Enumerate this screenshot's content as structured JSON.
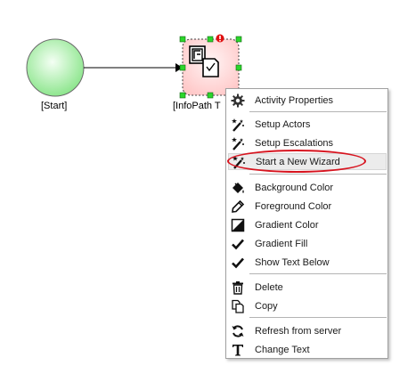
{
  "workflow": {
    "start_label": "[Start]",
    "infopath_label": "[InfoPath T",
    "colors": {
      "start_fill": "#8ee68e",
      "task_fill": "#ffd6d6",
      "handle": "#2bd62b",
      "warning": "#e01010"
    }
  },
  "context_menu": {
    "items": [
      {
        "label": "Activity Properties",
        "icon": "gear-icon"
      },
      {
        "label": "Setup Actors",
        "icon": "wand-icon"
      },
      {
        "label": "Setup Escalations",
        "icon": "wand-icon"
      },
      {
        "label": "Start a New Wizard",
        "icon": "wand-icon"
      },
      {
        "label": "Background Color",
        "icon": "paint-bucket-icon"
      },
      {
        "label": "Foreground Color",
        "icon": "pencil-icon"
      },
      {
        "label": "Gradient Color",
        "icon": "gradient-icon"
      },
      {
        "label": "Gradient Fill",
        "icon": "checkmark-icon"
      },
      {
        "label": "Show Text Below",
        "icon": "checkmark-icon"
      },
      {
        "label": "Delete",
        "icon": "trash-icon"
      },
      {
        "label": "Copy",
        "icon": "copy-icon"
      },
      {
        "label": "Refresh from server",
        "icon": "refresh-icon"
      },
      {
        "label": "Change Text",
        "icon": "text-icon"
      }
    ],
    "highlighted_item": "Start a New Wizard",
    "annotation_color": "#d7141f"
  }
}
